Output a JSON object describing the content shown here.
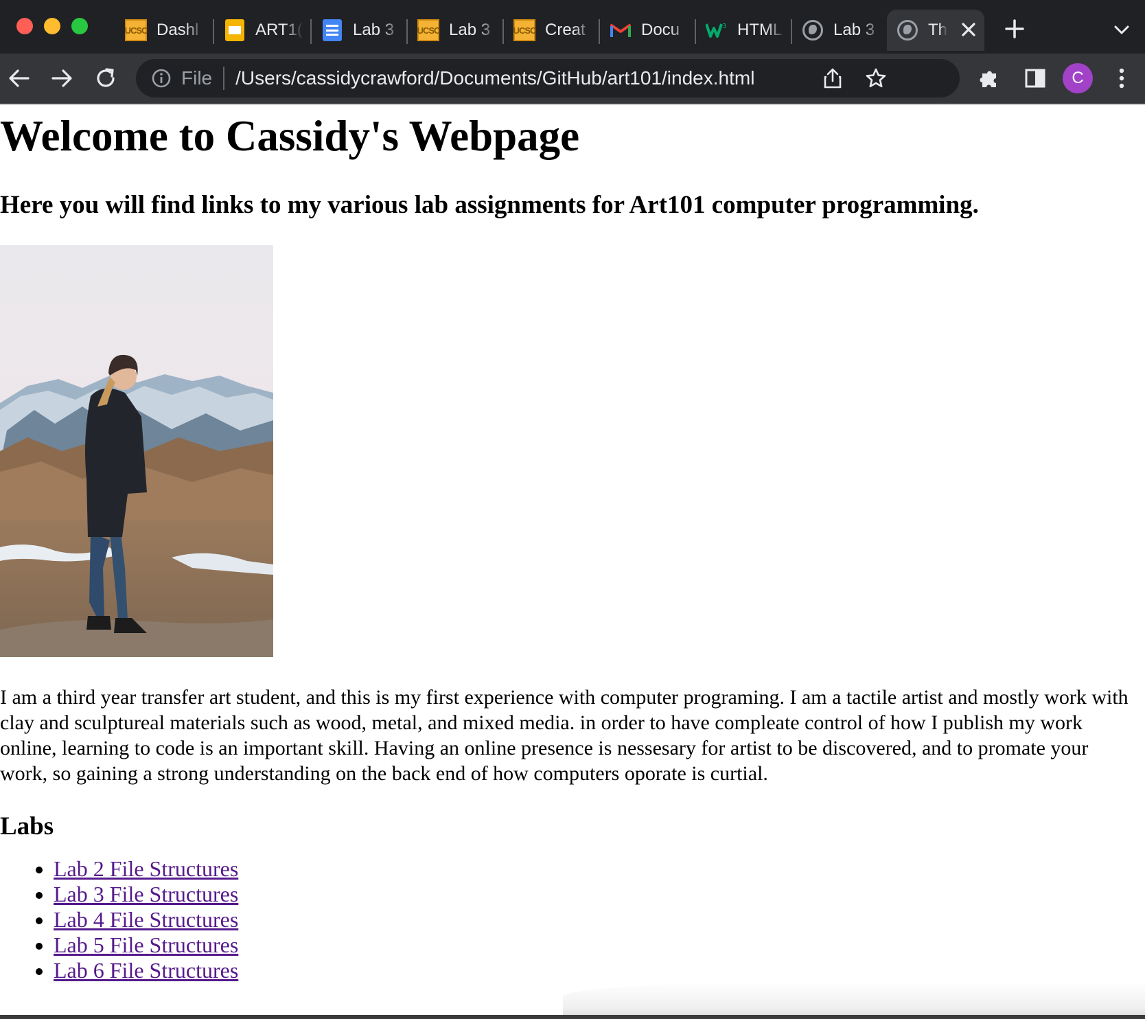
{
  "browser": {
    "tabs": [
      {
        "title": "Dashl",
        "icon": "ucsc-icon"
      },
      {
        "title": "ART1(",
        "icon": "slides-icon"
      },
      {
        "title": "Lab 3",
        "icon": "docs-icon"
      },
      {
        "title": "Lab 3",
        "icon": "ucsc-icon"
      },
      {
        "title": "Creat",
        "icon": "ucsc-icon"
      },
      {
        "title": "Docu",
        "icon": "gmail-icon"
      },
      {
        "title": "HTML",
        "icon": "w3schools-icon"
      },
      {
        "title": "Lab 3",
        "icon": "globe-icon"
      },
      {
        "title": "Th",
        "icon": "globe-icon",
        "active": true
      }
    ],
    "favicon_text": "UCSC",
    "address_bar": {
      "scheme_label": "File",
      "url": "/Users/cassidycrawford/Documents/GitHub/art101/index.html"
    },
    "profile_initial": "C",
    "colors": {
      "frame": "#202124",
      "toolbar": "#35363a",
      "avatar": "#a142c8"
    }
  },
  "page": {
    "title": "Welcome to Cassidy's Webpage",
    "subtitle": "Here you will find links to my various lab assignments for Art101 computer programming.",
    "bio": "I am a third year transfer art student, and this is my first experience with computer programing. I am a tactile artist and mostly work with clay and sculptureal materials such as wood, metal, and mixed media. in order to have compleate control of how I publish my work online, learning to code is an important skill. Having an online presence is nessesary for artist to be discovered, and to promate your work, so gaining a strong understanding on the back end of how computers oporate is curtial.",
    "labs_heading": "Labs",
    "labs": [
      "Lab 2 File Structures",
      "Lab 3 File Structures",
      "Lab 4 File Structures",
      "Lab 5 File Structures",
      "Lab 6 File Structures"
    ],
    "link_color": "#551a8b"
  }
}
